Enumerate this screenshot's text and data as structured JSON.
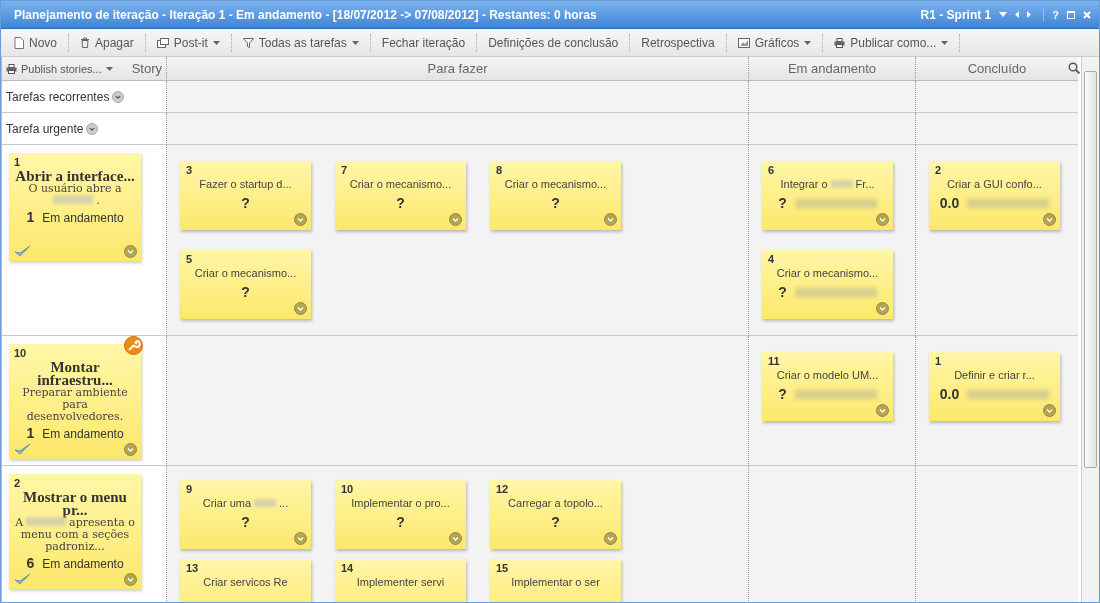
{
  "window": {
    "title": "Planejamento de iteração - Iteração 1 - Em andamento - [18/07/2012 -> 07/08/2012] - Restantes: 0 horas",
    "sprint": "R1 - Sprint 1",
    "help": "?"
  },
  "toolbar": [
    {
      "label": "Novo",
      "dropdown": false
    },
    {
      "label": "Apagar",
      "dropdown": false
    },
    {
      "label": "Post-it",
      "dropdown": true
    },
    {
      "label": "Todas as tarefas",
      "dropdown": true
    },
    {
      "label": "Fechar iteração",
      "dropdown": false
    },
    {
      "label": "Definições de conclusão",
      "dropdown": false
    },
    {
      "label": "Retrospectiva",
      "dropdown": false
    },
    {
      "label": "Gráficos",
      "dropdown": true
    },
    {
      "label": "Publicar como...",
      "dropdown": true
    }
  ],
  "publish_button": {
    "label": "Publish stories...",
    "dropdown": true
  },
  "columns": [
    {
      "label": "Story"
    },
    {
      "label": "Para fazer"
    },
    {
      "label": "Em andamento"
    },
    {
      "label": "Concluído"
    }
  ],
  "lanes": [
    {
      "kind": "category",
      "label": "Tarefas recorrentes"
    },
    {
      "kind": "category",
      "label": "Tarefa urgente"
    },
    {
      "kind": "story",
      "story": {
        "number": "1",
        "title": "Abrir a interface...",
        "desc": [
          "O usuário abre a",
          "."
        ],
        "count": "1",
        "status": "Em andamento",
        "tool": false
      },
      "cells": [
        [
          {
            "number": "3",
            "title": [
              "Fazer o startup d..."
            ],
            "estimate": "?",
            "owner_redacted": false
          },
          {
            "number": "7",
            "title": [
              "Criar o mecanismo..."
            ],
            "estimate": "?",
            "owner_redacted": false
          },
          {
            "number": "8",
            "title": [
              "Criar o mecanismo..."
            ],
            "estimate": "?",
            "owner_redacted": false
          },
          {
            "number": "5",
            "title": [
              "Criar o mecanismo..."
            ],
            "estimate": "?",
            "owner_redacted": false
          }
        ],
        [
          {
            "number": "6",
            "title": [
              "Integrar o",
              "Fr..."
            ],
            "estimate": "?",
            "owner_redacted": true
          },
          {
            "number": "4",
            "title": [
              "Criar o mecanismo..."
            ],
            "estimate": "?",
            "owner_redacted": true
          }
        ],
        [
          {
            "number": "2",
            "title": [
              "Criar a GUI confo..."
            ],
            "estimate": "0.0",
            "owner_redacted": true
          }
        ]
      ]
    },
    {
      "kind": "story",
      "story": {
        "number": "10",
        "title": "Montar infraestru...",
        "desc": [
          "Preparar ambiente para desenvolvedores."
        ],
        "count": "1",
        "status": "Em andamento",
        "tool": true
      },
      "cells": [
        [],
        [
          {
            "number": "11",
            "title": [
              "Criar o modelo UM..."
            ],
            "estimate": "?",
            "owner_redacted": true
          }
        ],
        [
          {
            "number": "1",
            "title": [
              "Definir e criar r..."
            ],
            "estimate": "0.0",
            "owner_redacted": true
          }
        ]
      ]
    },
    {
      "kind": "story",
      "story": {
        "number": "2",
        "title": "Mostrar o menu pr...",
        "desc": [
          "A",
          "apresenta o menu com a seções padroniz..."
        ],
        "count": "6",
        "status": "Em andamento",
        "tool": false
      },
      "cells": [
        [
          {
            "number": "9",
            "title": [
              "Criar uma",
              "..."
            ],
            "estimate": "?",
            "owner_redacted": false
          },
          {
            "number": "10",
            "title": [
              "Implementar o pro..."
            ],
            "estimate": "?",
            "owner_redacted": false
          },
          {
            "number": "12",
            "title": [
              "Carregar a topolo..."
            ],
            "estimate": "?",
            "owner_redacted": false
          },
          {
            "number": "13",
            "title": [
              "Criar servicos Re"
            ],
            "owner_redacted": false
          },
          {
            "number": "14",
            "title": [
              "Implementer servi"
            ],
            "owner_redacted": false
          },
          {
            "number": "15",
            "title": [
              "Implementar o ser"
            ],
            "owner_redacted": false
          }
        ],
        [],
        []
      ]
    }
  ]
}
